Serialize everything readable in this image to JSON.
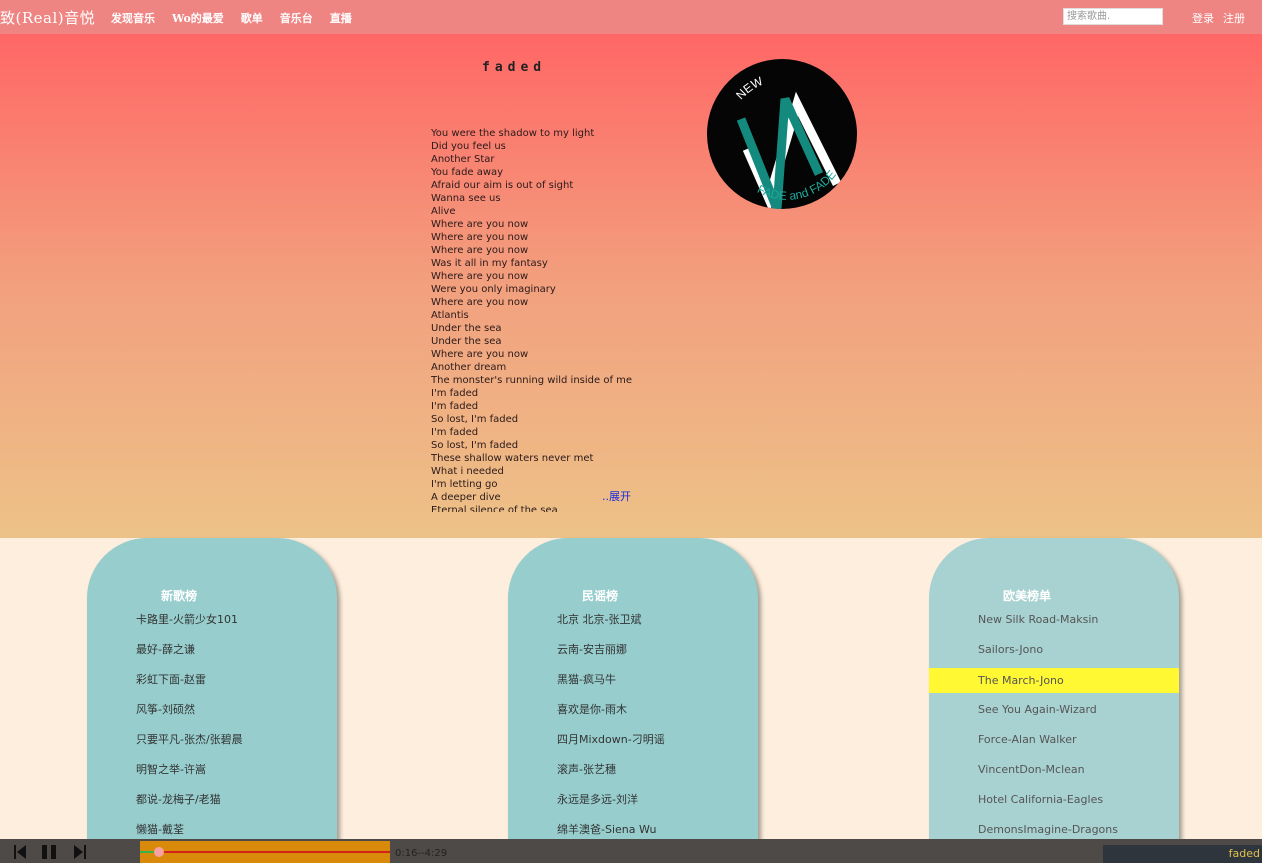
{
  "nav": {
    "logo": "致(Real)音悦",
    "links": [
      "发现音乐",
      "Wo的最爱",
      "歌单",
      "音乐台",
      "直播"
    ],
    "search_placeholder": "搜索歌曲.",
    "login": "登录",
    "register": "注册"
  },
  "song": {
    "title": "faded",
    "lyrics": [
      "You were the shadow to my light",
      "Did you feel us",
      "Another Star",
      "You fade away",
      "Afraid our aim is out of sight",
      "Wanna see us",
      "Alive",
      "Where are you now",
      "Where are you now",
      "Where are you now",
      "Was it all in my fantasy",
      "Where are you now",
      "Were you only imaginary",
      "Where are you now",
      "Atlantis",
      "Under the sea",
      "Under the sea",
      "Where are you now",
      "Another dream",
      "The monster's running wild inside of me",
      "I'm faded",
      "I'm faded",
      "So lost, I'm faded",
      "I'm faded",
      "So lost, I'm faded",
      "These shallow waters never met",
      "What i needed",
      "I'm letting go",
      "A deeper dive",
      "Eternal silence of the sea"
    ],
    "expand_label": "..展开",
    "cover": {
      "arc_top_text": "NEW",
      "arc_bottom_text": "FADE and FADE"
    }
  },
  "charts": [
    {
      "title": "新歌榜",
      "items": [
        "卡路里-火箭少女101",
        "最好-薛之谦",
        "彩虹下面-赵雷",
        "风筝-刘硕然",
        "只要平凡-张杰/张碧晨",
        "明智之举-许嵩",
        "都说-龙梅子/老猫",
        "懒猫-戴荃"
      ]
    },
    {
      "title": "民谣榜",
      "items": [
        "北京 北京-张卫斌",
        "云南-安吉丽娜",
        "黑猫-疯马牛",
        "喜欢是你-雨木",
        "四月Mixdown-刁明谣",
        "滚声-张艺穗",
        "永远是多远-刘洋",
        "绵羊澳爸-Siena Wu"
      ]
    },
    {
      "title": "欧美榜单",
      "items": [
        "New Silk Road-Maksin",
        "Sailors-Jono",
        "The March-Jono",
        "See You Again-Wizard",
        "Force-Alan Walker",
        "VincentDon-Mclean",
        "Hotel California-Eagles",
        "DemonsImagine-Dragons"
      ],
      "active_index": 2
    }
  ],
  "player": {
    "time_label": "0:16--4:29",
    "progress": 0.06,
    "now_playing": "faded",
    "colors": {
      "bar": "#4d4a48",
      "progress_bg": "#da8a0a",
      "played": "#38b24a",
      "track": "#d2221a"
    }
  },
  "colors": {
    "topbar": "#ef8583",
    "hero_top": "#ff6766",
    "hero_bottom": "#edc288",
    "card": "#97cdcd",
    "highlight": "#fff832"
  }
}
